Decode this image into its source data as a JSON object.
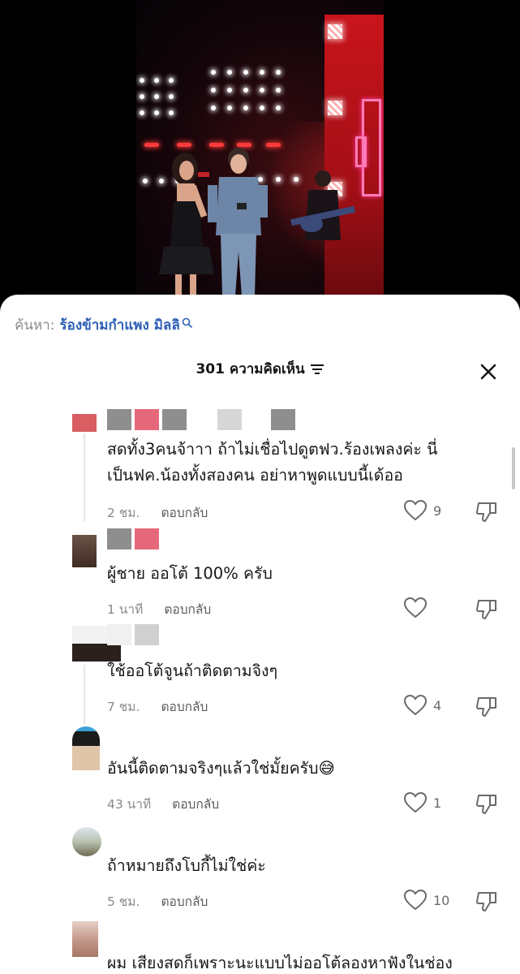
{
  "search": {
    "label": "ค้นหา:",
    "query": "ร้องข้ามกำแพง มิลลิ"
  },
  "header": {
    "count_label": "301 ความคิดเห็น"
  },
  "comments": [
    {
      "text": "สดทั้ง3คนจ้าาา ถ้าไม่เชื่อไปดูตฟว.ร้องเพลงค่ะ นี่\nเป็นฟค.น้องทั้งสองคน อย่าหาพูดแบบนี้เด้ออ",
      "time": "2 ชม.",
      "reply": "ตอบกลับ",
      "likes": "9"
    },
    {
      "text": "ผู้ชาย ออโต้ 100% ครับ",
      "time": "1 นาที",
      "reply": "ตอบกลับ",
      "likes": ""
    },
    {
      "text": "ใช้ออโต้จูนถ้าติดตามจิงๆ",
      "time": "7 ชม.",
      "reply": "ตอบกลับ",
      "likes": "4"
    },
    {
      "text": "อันนี้ติดตามจริงๆแล้วใช่มั้ยครับ😅",
      "time": "43 นาที",
      "reply": "ตอบกลับ",
      "likes": "1"
    },
    {
      "text": "ถ้าหมายถึงโบกี้ไม่ใช่ค่ะ",
      "time": "5 ชม.",
      "reply": "ตอบกลับ",
      "likes": "10"
    },
    {
      "text": "ผม เสียงสดก็เพราะนะแบบไม่ออโต้ลองหาฟังในช่อง",
      "time": "",
      "reply": "",
      "likes": ""
    }
  ],
  "colors": {
    "sheet_bg": "#ffffff",
    "search_term": "#2d5fb6",
    "text_primary": "#161616",
    "text_secondary": "#8a8a8a",
    "stage_red": "#c9141c"
  },
  "icons": {
    "search": "search-icon",
    "filter": "filter-icon",
    "close": "close-icon",
    "like": "heart-icon",
    "dislike": "thumbs-down-icon"
  }
}
